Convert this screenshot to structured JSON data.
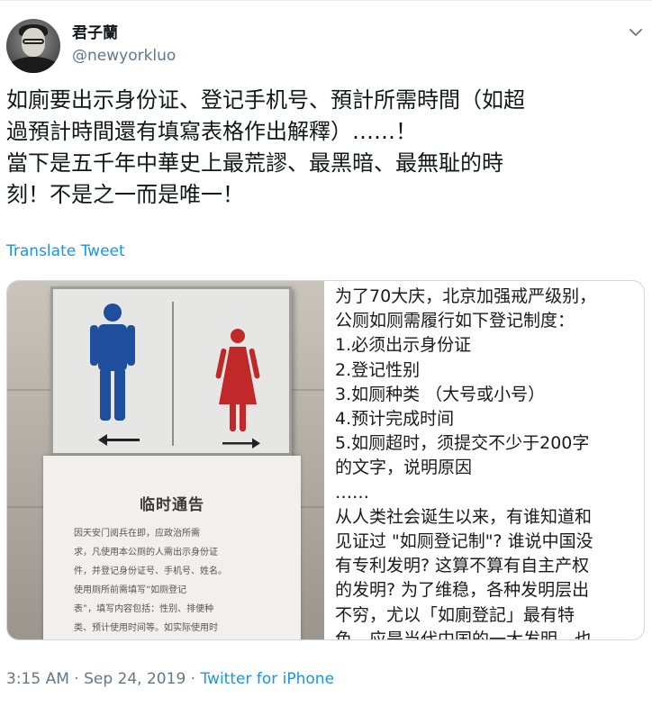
{
  "author": {
    "display_name": "君子蘭",
    "handle": "@newyorkluo"
  },
  "tweet": {
    "lines": [
      "如廁要出示身份证、登记手机号、預計所需時間（如超",
      "過預計時間還有填寫表格作出解釋）……！",
      "當下是五千年中華史上最荒謬、最黑暗、最無耻的時",
      "刻！不是之一而是唯一！"
    ],
    "translate_label": "Translate Tweet"
  },
  "media": {
    "notice_title": "临时通告",
    "notice_lines": [
      "因天安门阅兵在即，应政治所需",
      "求，凡使用本公厕的人需出示身份证",
      "件，并登记身份证号、手机号、姓名。",
      "使用厕所前需填写“如厕登记",
      "表”，填写内容包括：性别、排便种",
      "类、预计使用时间等。如实际使用时"
    ],
    "caption_lines": [
      "为了70大庆，北京加强戒严级别，",
      "公厕如厕需履行如下登记制度：",
      "1.必须出示身份证",
      "2.登记性别",
      "3.如厕种类 （大号或小号）",
      "4.预计完成时间",
      "5.如厕超时，须提交不少于200字",
      "的文字，说明原因",
      "……",
      "从人类社会诞生以来，有谁知道和",
      "见证过 \"如厕登记制\"? 谁说中国没",
      "有专利发明? 这算不算有自主产权",
      "的发明? 为了维稳，各种发明层出",
      "不穷，尤以「如廁登記」最有特",
      "色，应是当代中国的一大发明。也"
    ],
    "man_color": "#1f4f9c",
    "woman_color": "#c0282a"
  },
  "meta": {
    "time": "3:15 AM",
    "separator": " · ",
    "date": "Sep 24, 2019",
    "source": "Twitter for iPhone"
  },
  "icons": {
    "caret": "chevron-down-icon"
  }
}
